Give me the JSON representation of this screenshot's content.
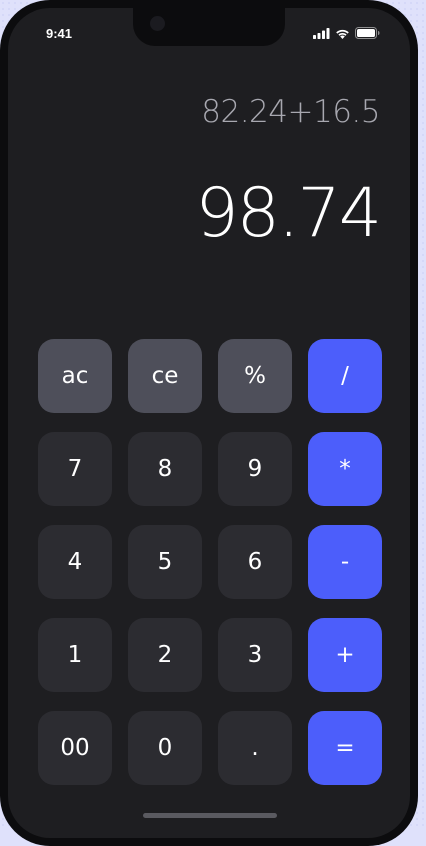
{
  "status_bar": {
    "time": "9:41",
    "icons": [
      "cellular-signal-icon",
      "wifi-icon",
      "battery-icon"
    ]
  },
  "display": {
    "expression": "82.24+16.5",
    "result": "98.74"
  },
  "keypad": {
    "rows": [
      [
        {
          "label": "ac",
          "kind": "func",
          "name": "all-clear-button"
        },
        {
          "label": "ce",
          "kind": "func",
          "name": "clear-entry-button"
        },
        {
          "label": "%",
          "kind": "func",
          "name": "percent-button"
        },
        {
          "label": "/",
          "kind": "op",
          "name": "divide-button"
        }
      ],
      [
        {
          "label": "7",
          "kind": "num",
          "name": "digit-7-button"
        },
        {
          "label": "8",
          "kind": "num",
          "name": "digit-8-button"
        },
        {
          "label": "9",
          "kind": "num",
          "name": "digit-9-button"
        },
        {
          "label": "*",
          "kind": "op",
          "name": "multiply-button"
        }
      ],
      [
        {
          "label": "4",
          "kind": "num",
          "name": "digit-4-button"
        },
        {
          "label": "5",
          "kind": "num",
          "name": "digit-5-button"
        },
        {
          "label": "6",
          "kind": "num",
          "name": "digit-6-button"
        },
        {
          "label": "-",
          "kind": "op",
          "name": "subtract-button"
        }
      ],
      [
        {
          "label": "1",
          "kind": "num",
          "name": "digit-1-button"
        },
        {
          "label": "2",
          "kind": "num",
          "name": "digit-2-button"
        },
        {
          "label": "3",
          "kind": "num",
          "name": "digit-3-button"
        },
        {
          "label": "+",
          "kind": "op",
          "name": "add-button"
        }
      ],
      [
        {
          "label": "00",
          "kind": "num",
          "name": "double-zero-button"
        },
        {
          "label": "0",
          "kind": "num",
          "name": "digit-0-button"
        },
        {
          "label": ".",
          "kind": "num",
          "name": "decimal-point-button"
        },
        {
          "label": "=",
          "kind": "op",
          "name": "equals-button"
        }
      ]
    ]
  },
  "colors": {
    "operator_accent": "#4c5efb",
    "function_key": "#4e4f5a",
    "number_key": "#2c2c31",
    "screen_background": "#1e1e21"
  }
}
